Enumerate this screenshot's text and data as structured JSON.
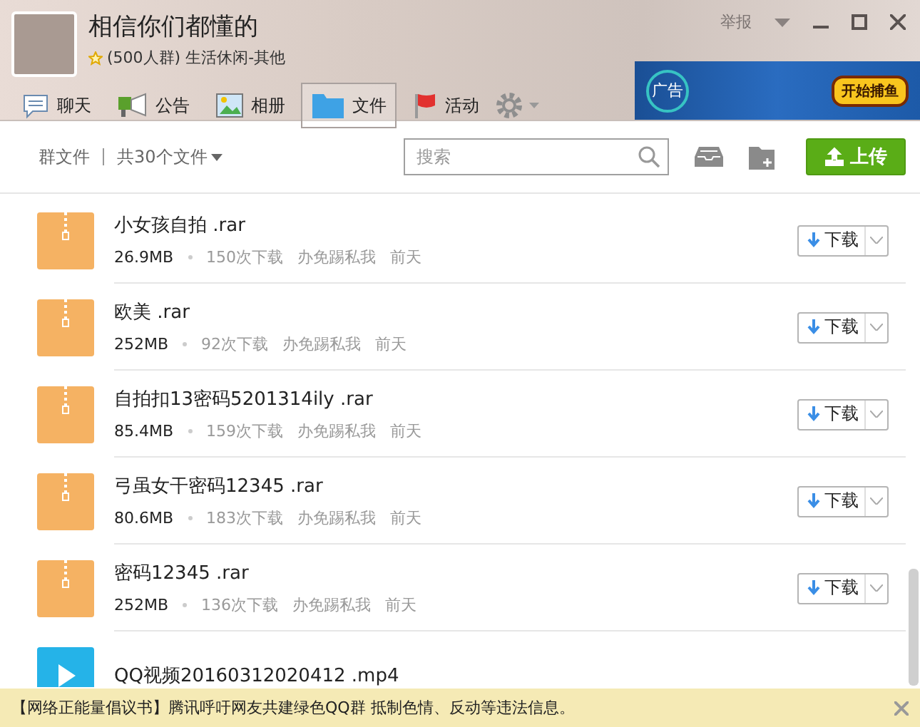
{
  "header": {
    "group_name": "相信你们都懂的",
    "group_info": "(500人群) 生活休闲-其他",
    "report": "举报",
    "ad": {
      "label": "广告",
      "action": "开始捕鱼"
    }
  },
  "tabs": [
    {
      "label": "聊天",
      "selected": false
    },
    {
      "label": "公告",
      "selected": false
    },
    {
      "label": "相册",
      "selected": false
    },
    {
      "label": "文件",
      "selected": true
    },
    {
      "label": "活动",
      "selected": false
    }
  ],
  "toolbar": {
    "breadcrumb": "群文件",
    "count": "共30个文件",
    "search_placeholder": "搜索",
    "upload": "上传"
  },
  "files": [
    {
      "kind": "archive",
      "name": "小女孩自拍",
      "ext": ".rar",
      "size": "26.9MB",
      "downloads": "150次下载",
      "uploader": "办免踢私我",
      "date": "前天",
      "action": "下载"
    },
    {
      "kind": "archive",
      "name": "欧美",
      "ext": ".rar",
      "size": "252MB",
      "downloads": "92次下载",
      "uploader": "办免踢私我",
      "date": "前天",
      "action": "下载"
    },
    {
      "kind": "archive",
      "name": "自拍扣13密码5201314ily",
      "ext": ".rar",
      "size": "85.4MB",
      "downloads": "159次下载",
      "uploader": "办免踢私我",
      "date": "前天",
      "action": "下载"
    },
    {
      "kind": "archive",
      "name": "弓虽女干密码12345",
      "ext": ".rar",
      "size": "80.6MB",
      "downloads": "183次下载",
      "uploader": "办免踢私我",
      "date": "前天",
      "action": "下载"
    },
    {
      "kind": "archive",
      "name": "密码12345",
      "ext": ".rar",
      "size": "252MB",
      "downloads": "136次下载",
      "uploader": "办免踢私我",
      "date": "前天",
      "action": "下载"
    },
    {
      "kind": "video",
      "name": "QQ视频20160312020412",
      "ext": ".mp4"
    }
  ],
  "notice": "【网络正能量倡议书】腾讯呼吁网友共建绿色QQ群 抵制色情、反动等违法信息。"
}
